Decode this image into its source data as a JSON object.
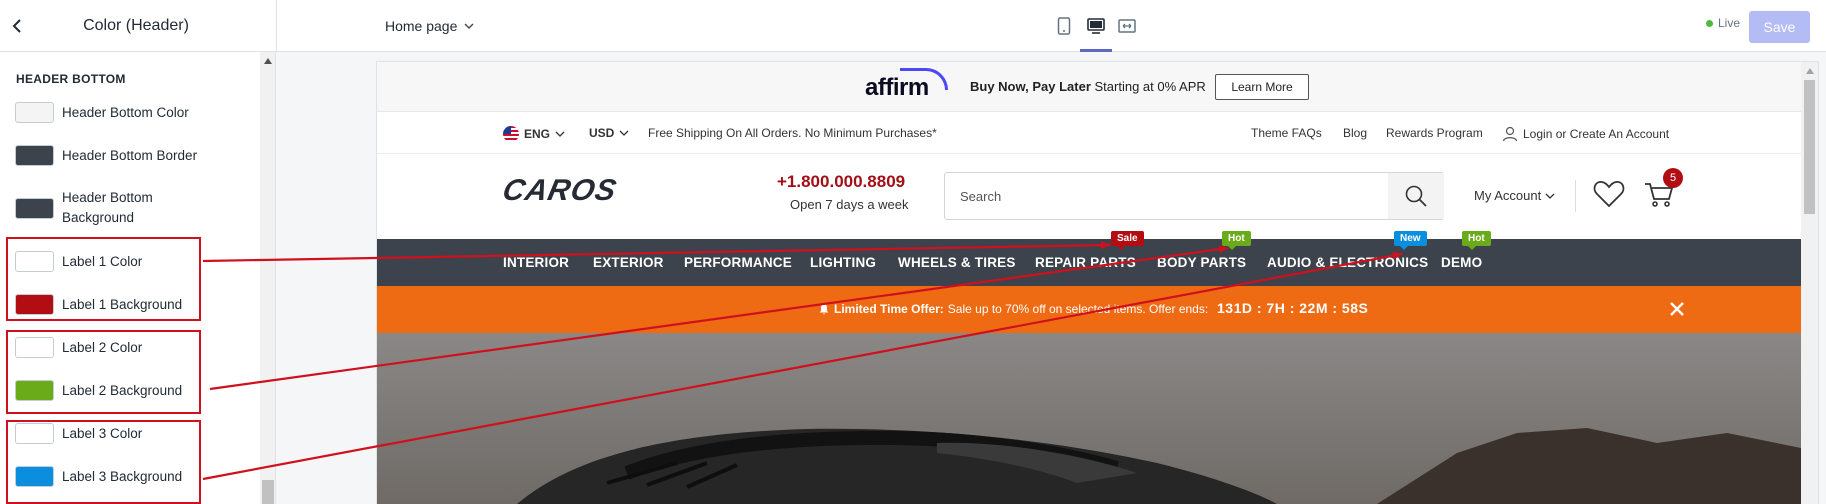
{
  "editor": {
    "panel_title": "Color (Header)",
    "page_select": "Home page",
    "live_label": "Live",
    "save_label": "Save"
  },
  "sidebar": {
    "section_title": "HEADER BOTTOM",
    "settings": [
      {
        "label": "Header Bottom Color",
        "color": "#f4f4f4"
      },
      {
        "label": "Header Bottom Border",
        "color": "#3d434c"
      },
      {
        "label": "Header Bottom Background",
        "color": "#3d434c"
      },
      {
        "label": "Label 1 Color",
        "color": "#ffffff"
      },
      {
        "label": "Label 1 Background",
        "color": "#b30d14"
      },
      {
        "label": "Label 2 Color",
        "color": "#ffffff"
      },
      {
        "label": "Label 2 Background",
        "color": "#6aab19"
      },
      {
        "label": "Label 3 Color",
        "color": "#ffffff"
      },
      {
        "label": "Label 3 Background",
        "color": "#0c8ede"
      }
    ]
  },
  "store": {
    "affirm": {
      "logo": "affirm",
      "text_bold": "Buy Now, Pay Later",
      "text_rest": " Starting at 0% APR",
      "button": "Learn More"
    },
    "utility": {
      "language": "ENG",
      "currency": "USD",
      "shipping": "Free Shipping On All Orders. No Minimum Purchases*",
      "links": [
        "Theme FAQs",
        "Blog",
        "Rewards Program",
        "Login or Create An Account"
      ]
    },
    "header": {
      "logo": "CAROS",
      "phone": "+1.800.000.8809",
      "hours": "Open 7 days a week",
      "search_placeholder": "Search",
      "account": "My Account",
      "cart_count": "5"
    },
    "nav": [
      {
        "label": "INTERIOR"
      },
      {
        "label": "EXTERIOR"
      },
      {
        "label": "PERFORMANCE"
      },
      {
        "label": "LIGHTING"
      },
      {
        "label": "WHEELS & TIRES"
      },
      {
        "label": "REPAIR PARTS",
        "badge": "Sale",
        "badge_color": "#b30d14"
      },
      {
        "label": "BODY PARTS",
        "badge": "Hot",
        "badge_color": "#6aab19"
      },
      {
        "label": "AUDIO & ELECTRONICS",
        "badge": "New",
        "badge_color": "#0c8ede"
      },
      {
        "label": "DEMO",
        "badge": "Hot",
        "badge_color": "#6aab19"
      }
    ],
    "promo": {
      "bold": "Limited Time Offer:",
      "rest": " Sale up to 70% off on selected items. Offer ends:",
      "countdown": "131D : 7H : 22M : 58S"
    }
  },
  "annotation_color": "#d0101c"
}
